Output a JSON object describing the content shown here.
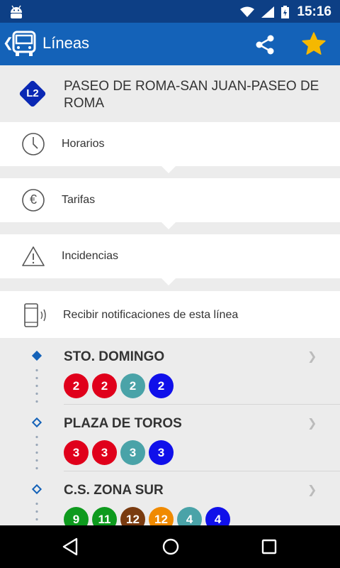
{
  "status_bar": {
    "time": "15:16"
  },
  "app_bar": {
    "back_icon": "chevron-left-icon",
    "logo_icon": "bus-icon",
    "title": "Líneas",
    "share_icon": "share-icon",
    "favorite_icon": "star-icon"
  },
  "line": {
    "code": "L2",
    "name": "PASEO DE ROMA-SAN JUAN-PASEO DE ROMA"
  },
  "menu": [
    {
      "label": "Horarios",
      "icon": "clock-icon"
    },
    {
      "label": "Tarifas",
      "icon": "euro-icon"
    },
    {
      "label": "Incidencias",
      "icon": "warning-icon"
    }
  ],
  "notifications": {
    "label": "Recibir notificaciones de esta línea",
    "icon": "phone-vibrate-icon"
  },
  "stops": [
    {
      "name": "STO. DOMINGO",
      "buses": [
        {
          "label": "2",
          "color": "#e0001b"
        },
        {
          "label": "2",
          "color": "#e0001b"
        },
        {
          "label": "2",
          "color": "#4aa3a8"
        },
        {
          "label": "2",
          "color": "#1010ea"
        }
      ]
    },
    {
      "name": "PLAZA DE TOROS",
      "buses": [
        {
          "label": "3",
          "color": "#e0001b"
        },
        {
          "label": "3",
          "color": "#e0001b"
        },
        {
          "label": "3",
          "color": "#4aa3a8"
        },
        {
          "label": "3",
          "color": "#1010ea"
        }
      ]
    },
    {
      "name": "C.S. ZONA SUR",
      "buses": [
        {
          "label": "9",
          "color": "#0e9a1e"
        },
        {
          "label": "11",
          "color": "#0e9a1e"
        },
        {
          "label": "12",
          "color": "#7a3b10"
        },
        {
          "label": "12",
          "color": "#f08a00"
        },
        {
          "label": "4",
          "color": "#4aa3a8"
        },
        {
          "label": "4",
          "color": "#1010ea"
        }
      ]
    }
  ],
  "colors": {
    "status_bar": "#0d3f85",
    "app_bar": "#1462b8",
    "accent_star": "#f5b800",
    "stop_marker": "#1462b8"
  }
}
